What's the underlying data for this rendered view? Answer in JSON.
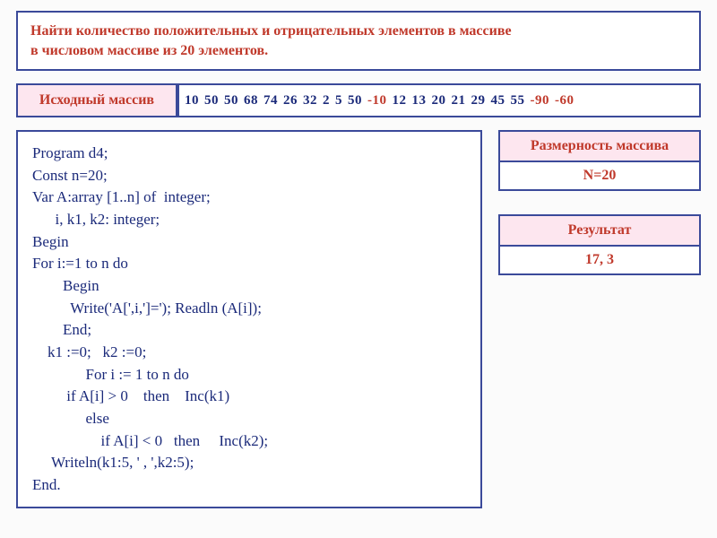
{
  "task": {
    "line1": "Найти количество положительных и отрицательных элементов в массиве",
    "line2": "в числовом массиве из 20 элементов."
  },
  "array_label": "Исходный массив",
  "array_values": [
    {
      "v": "10",
      "neg": false
    },
    {
      "v": "50",
      "neg": false
    },
    {
      "v": "50",
      "neg": false
    },
    {
      "v": "68",
      "neg": false
    },
    {
      "v": "74",
      "neg": false
    },
    {
      "v": "26",
      "neg": false
    },
    {
      "v": "32",
      "neg": false
    },
    {
      "v": "2",
      "neg": false
    },
    {
      "v": "5",
      "neg": false
    },
    {
      "v": "50",
      "neg": false
    },
    {
      "v": "-10",
      "neg": true
    },
    {
      "v": "12",
      "neg": false
    },
    {
      "v": "13",
      "neg": false
    },
    {
      "v": "20",
      "neg": false
    },
    {
      "v": "21",
      "neg": false
    },
    {
      "v": "29",
      "neg": false
    },
    {
      "v": "45",
      "neg": false
    },
    {
      "v": "55",
      "neg": false
    },
    {
      "v": "-90",
      "neg": true
    },
    {
      "v": "-60",
      "neg": true
    }
  ],
  "code": {
    "l1": "Program d4;",
    "l2": "Const n=20;",
    "l3": "Var A:array [1..n] of  integer;",
    "l4": "      i, k1, k2: integer;",
    "l5": "Begin",
    "l6": "For i:=1 to n do",
    "l7": "        Begin",
    "l8": "          Write('A[',i,']='); Readln (A[i]);",
    "l9": "        End;",
    "l10": "    k1 :=0;   k2 :=0;",
    "l11": "              For i := 1 to n do",
    "l12": "         if A[i] > 0    then    Inc(k1)",
    "l13": "              else",
    "l14": "                  if A[i] < 0   then     Inc(k2);",
    "l15": "     Writeln(k1:5, ' , ',k2:5);",
    "l16": "End."
  },
  "dim": {
    "header": "Размерность массива",
    "value": "N=20"
  },
  "result": {
    "header": "Результат",
    "value": "17,   3"
  }
}
